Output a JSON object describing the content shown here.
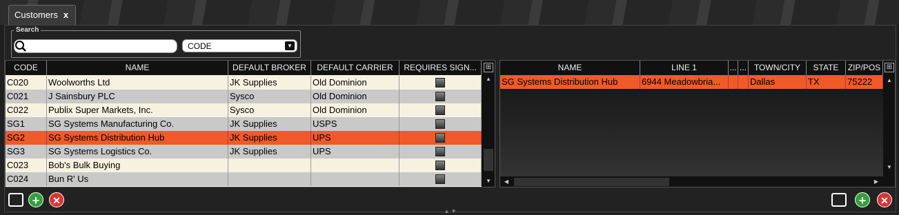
{
  "tab": {
    "label": "Customers",
    "close": "x"
  },
  "search": {
    "legend": "Search",
    "value": "",
    "field": "CODE"
  },
  "left_grid": {
    "columns": [
      "CODE",
      "NAME",
      "DEFAULT BROKER",
      "DEFAULT CARRIER",
      "REQUIRES SIGN..."
    ],
    "rows": [
      [
        "C020",
        "Woolworths Ltd",
        "JK Supplies",
        "Old Dominion"
      ],
      [
        "C021",
        "J Sainsbury PLC",
        "Sysco",
        "Old Dominion"
      ],
      [
        "C022",
        "Publix Super Markets, Inc.",
        "Sysco",
        "Old Dominion"
      ],
      [
        "SG1",
        "SG Systems Manufacturing Co.",
        "JK Supplies",
        "USPS"
      ],
      [
        "SG2",
        "SG Systems Distribution Hub",
        "JK Supplies",
        "UPS"
      ],
      [
        "SG3",
        "SG Systems Logistics Co.",
        "JK Supplies",
        "UPS"
      ],
      [
        "C023",
        "Bob's Bulk Buying",
        "",
        ""
      ],
      [
        "C024",
        "Bun R' Us",
        "",
        ""
      ]
    ],
    "selected_row": 4
  },
  "right_grid": {
    "columns": [
      "NAME",
      "LINE 1",
      "...",
      "...",
      "TOWN/CITY",
      "STATE",
      "ZIP/POS"
    ],
    "rows": [
      [
        "SG Systems Distribution Hub",
        "6944 Meadowbria...",
        "",
        "",
        "Dallas",
        "TX",
        "75222"
      ]
    ],
    "selected_row": 0
  },
  "colors": {
    "selected": "#f05a28",
    "odd": "#f7f2e0",
    "even": "#c9c9c9",
    "add": "#2fa33a",
    "delete": "#dd3333"
  },
  "icons": {
    "search": "search-icon",
    "export": "export-icon",
    "add": "add-icon",
    "delete": "delete-icon",
    "grid-menu": "grid-menu-icon"
  }
}
